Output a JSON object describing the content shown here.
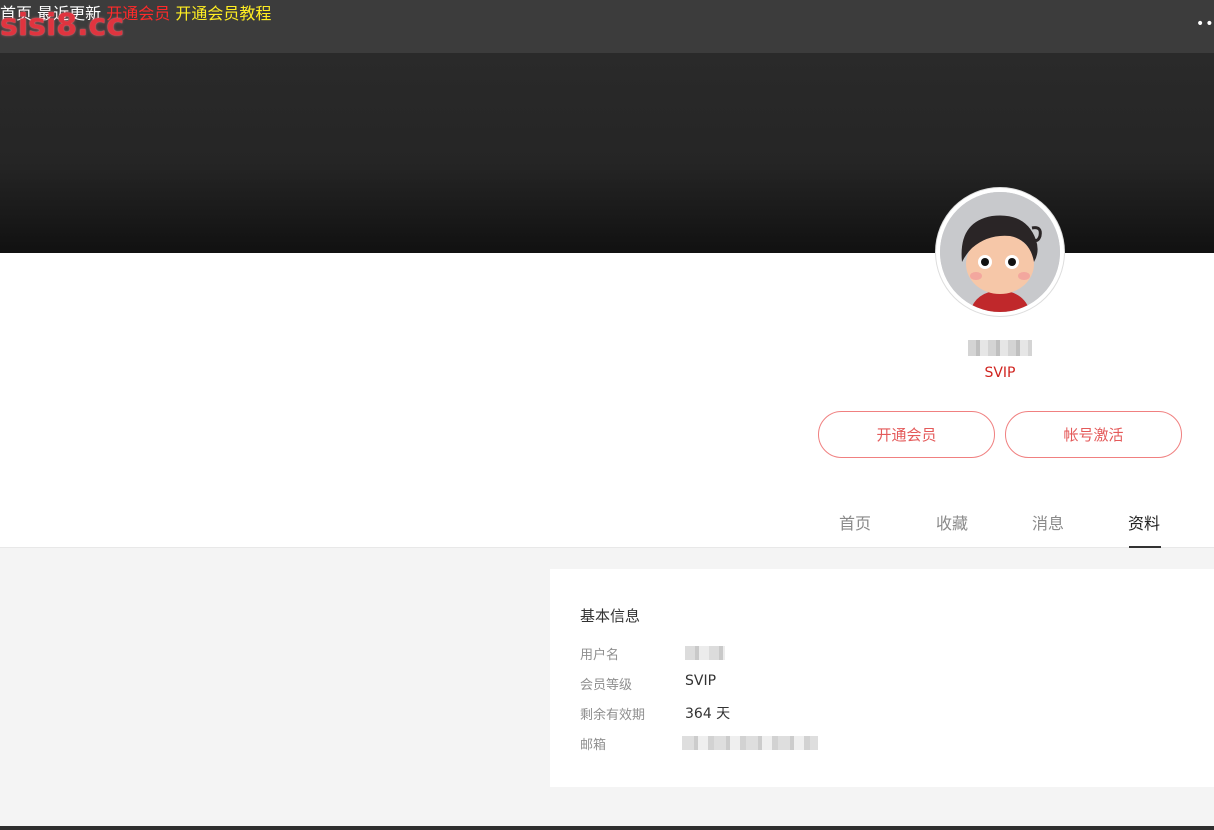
{
  "header": {
    "logo": "sisi8.cc",
    "nav": [
      {
        "label": "首页",
        "color": "#ffffff"
      },
      {
        "label": "最近更新",
        "color": "#ffffff"
      },
      {
        "label": "开通会员",
        "color": "#ff2a2a"
      },
      {
        "label": "开通会员教程",
        "color": "#ffee22"
      }
    ],
    "more": "••"
  },
  "profile": {
    "level": "SVIP",
    "buttons": {
      "join_vip": "开通会员",
      "activate": "帐号激活"
    },
    "tabs": [
      {
        "label": "首页"
      },
      {
        "label": "收藏"
      },
      {
        "label": "消息"
      },
      {
        "label": "资料",
        "active": true
      }
    ]
  },
  "info": {
    "title": "基本信息",
    "rows": [
      {
        "label": "用户名",
        "value": ""
      },
      {
        "label": "会员等级",
        "value": "SVIP"
      },
      {
        "label": "剩余有效期",
        "value": "364 天"
      },
      {
        "label": "邮箱",
        "value": ""
      }
    ]
  },
  "colors": {
    "accent": "#d0241f",
    "button_border": "#f08080",
    "nav_bg": "#3c3c3c"
  }
}
